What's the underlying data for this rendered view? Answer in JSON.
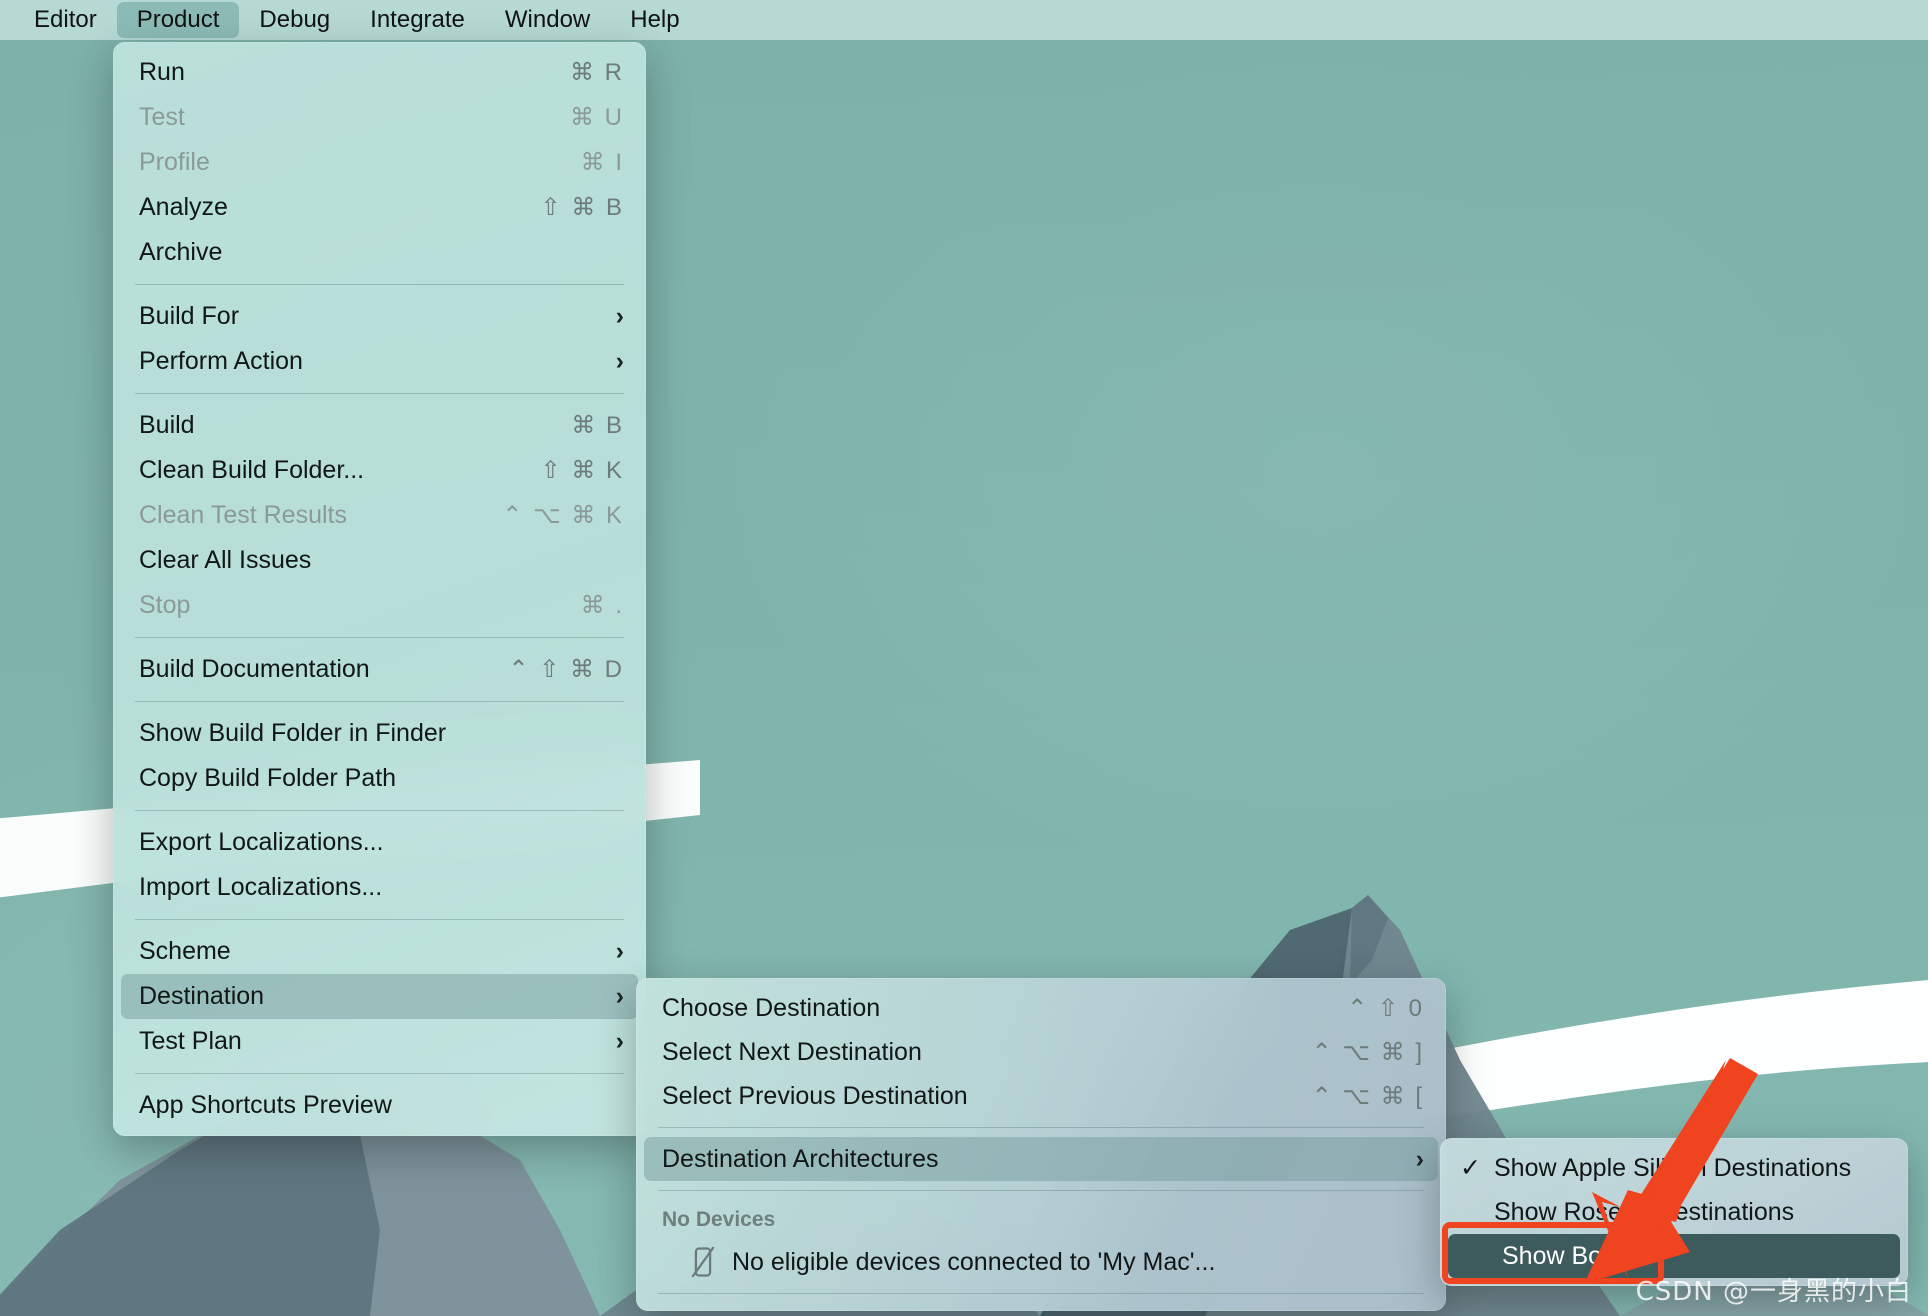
{
  "menubar": {
    "items": [
      {
        "label": "Editor",
        "active": false
      },
      {
        "label": "Product",
        "active": true
      },
      {
        "label": "Debug",
        "active": false
      },
      {
        "label": "Integrate",
        "active": false
      },
      {
        "label": "Window",
        "active": false
      },
      {
        "label": "Help",
        "active": false
      }
    ]
  },
  "product_menu": {
    "rows": [
      {
        "type": "item",
        "label": "Run",
        "shortcut": "⌘ R",
        "disabled": false,
        "submenu": false,
        "name": "run"
      },
      {
        "type": "item",
        "label": "Test",
        "shortcut": "⌘ U",
        "disabled": true,
        "submenu": false,
        "name": "test"
      },
      {
        "type": "item",
        "label": "Profile",
        "shortcut": "⌘ I",
        "disabled": true,
        "submenu": false,
        "name": "profile"
      },
      {
        "type": "item",
        "label": "Analyze",
        "shortcut": "⇧ ⌘ B",
        "disabled": false,
        "submenu": false,
        "name": "analyze"
      },
      {
        "type": "item",
        "label": "Archive",
        "shortcut": "",
        "disabled": false,
        "submenu": false,
        "name": "archive"
      },
      {
        "type": "sep"
      },
      {
        "type": "item",
        "label": "Build For",
        "shortcut": "",
        "disabled": false,
        "submenu": true,
        "name": "build-for"
      },
      {
        "type": "item",
        "label": "Perform Action",
        "shortcut": "",
        "disabled": false,
        "submenu": true,
        "name": "perform-action"
      },
      {
        "type": "sep"
      },
      {
        "type": "item",
        "label": "Build",
        "shortcut": "⌘ B",
        "disabled": false,
        "submenu": false,
        "name": "build"
      },
      {
        "type": "item",
        "label": "Clean Build Folder...",
        "shortcut": "⇧ ⌘ K",
        "disabled": false,
        "submenu": false,
        "name": "clean-build-folder"
      },
      {
        "type": "item",
        "label": "Clean Test Results",
        "shortcut": "⌃ ⌥ ⌘ K",
        "disabled": true,
        "submenu": false,
        "name": "clean-test-results"
      },
      {
        "type": "item",
        "label": "Clear All Issues",
        "shortcut": "",
        "disabled": false,
        "submenu": false,
        "name": "clear-all-issues"
      },
      {
        "type": "item",
        "label": "Stop",
        "shortcut": "⌘ .",
        "disabled": true,
        "submenu": false,
        "name": "stop"
      },
      {
        "type": "sep"
      },
      {
        "type": "item",
        "label": "Build Documentation",
        "shortcut": "⌃ ⇧ ⌘ D",
        "disabled": false,
        "submenu": false,
        "name": "build-documentation"
      },
      {
        "type": "sep"
      },
      {
        "type": "item",
        "label": "Show Build Folder in Finder",
        "shortcut": "",
        "disabled": false,
        "submenu": false,
        "name": "show-build-folder-in-finder"
      },
      {
        "type": "item",
        "label": "Copy Build Folder Path",
        "shortcut": "",
        "disabled": false,
        "submenu": false,
        "name": "copy-build-folder-path"
      },
      {
        "type": "sep"
      },
      {
        "type": "item",
        "label": "Export Localizations...",
        "shortcut": "",
        "disabled": false,
        "submenu": false,
        "name": "export-localizations"
      },
      {
        "type": "item",
        "label": "Import Localizations...",
        "shortcut": "",
        "disabled": false,
        "submenu": false,
        "name": "import-localizations"
      },
      {
        "type": "sep"
      },
      {
        "type": "item",
        "label": "Scheme",
        "shortcut": "",
        "disabled": false,
        "submenu": true,
        "name": "scheme"
      },
      {
        "type": "item",
        "label": "Destination",
        "shortcut": "",
        "disabled": false,
        "submenu": true,
        "highlighted": true,
        "name": "destination"
      },
      {
        "type": "item",
        "label": "Test Plan",
        "shortcut": "",
        "disabled": false,
        "submenu": true,
        "name": "test-plan"
      },
      {
        "type": "sep"
      },
      {
        "type": "item",
        "label": "App Shortcuts Preview",
        "shortcut": "",
        "disabled": false,
        "submenu": false,
        "name": "app-shortcuts-preview"
      }
    ]
  },
  "destination_menu": {
    "rows": [
      {
        "type": "item",
        "label": "Choose Destination",
        "shortcut": "⌃ ⇧ 0",
        "disabled": false,
        "submenu": false,
        "name": "choose-destination"
      },
      {
        "type": "item",
        "label": "Select Next Destination",
        "shortcut": "⌃ ⌥ ⌘ ]",
        "disabled": false,
        "submenu": false,
        "name": "select-next-destination"
      },
      {
        "type": "item",
        "label": "Select Previous Destination",
        "shortcut": "⌃ ⌥ ⌘ [",
        "disabled": false,
        "submenu": false,
        "name": "select-previous-destination"
      },
      {
        "type": "sep"
      },
      {
        "type": "item",
        "label": "Destination Architectures",
        "shortcut": "",
        "disabled": false,
        "submenu": true,
        "highlighted": true,
        "name": "destination-architectures"
      },
      {
        "type": "sep"
      },
      {
        "type": "header",
        "label": "No Devices",
        "name": "no-devices-header"
      },
      {
        "type": "device",
        "label": "No eligible devices connected to 'My Mac'...",
        "icon": "phone-slash-icon",
        "name": "no-eligible-devices"
      },
      {
        "type": "sep"
      }
    ]
  },
  "arch_menu": {
    "rows": [
      {
        "label": "Show Apple Silicon Destinations",
        "checked": true,
        "selected": false,
        "name": "show-apple-silicon-destinations"
      },
      {
        "label": "Show Rosetta Destinations",
        "checked": false,
        "selected": false,
        "name": "show-rosetta-destinations"
      },
      {
        "label": "Show Both",
        "checked": false,
        "selected": true,
        "name": "show-both"
      }
    ],
    "check_glyph": "✓"
  },
  "annotation": {
    "highlight_color": "#f0431f",
    "arrow_color": "#f0431f",
    "target": "Show Both"
  },
  "watermark": {
    "text": "CSDN @一身黑的小白"
  }
}
